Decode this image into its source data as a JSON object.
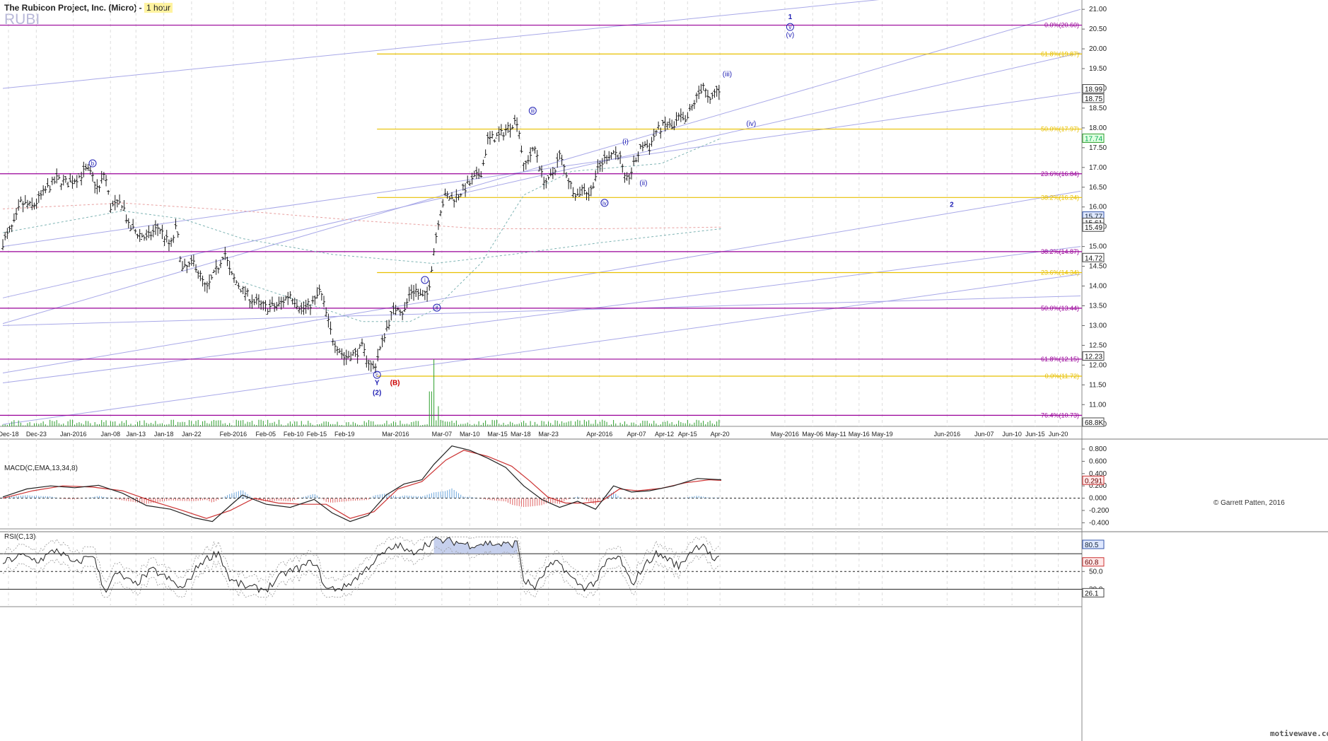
{
  "header": {
    "title": "The Rubicon Project, Inc. (Micro) -",
    "timeframe": "1 hour",
    "symbol": "RUBI",
    "copyright": "© Garrett Patten, 2016",
    "brand": "motivewave.com"
  },
  "colors": {
    "price_bar": "#1a1a1a",
    "magenta_fib": "#990099",
    "gold_fib": "#e8c000",
    "trend_line": "#a8a8e8",
    "wave_label": "#1f1fb4",
    "wave_label_red": "#cc0000",
    "volume": "#2e9e2e",
    "macd_line": "#222222",
    "macd_signal": "#cc3333",
    "histo_pos": "#6fa8dc",
    "histo_neg": "#e06666",
    "rsi_line": "#222222",
    "rsi_band": "#999999",
    "ma_dash": "#7fb4b4"
  },
  "chart_data": [
    {
      "type": "ohlc",
      "pane": "price",
      "ylim": [
        10.45,
        21.2
      ],
      "y_ticks": [
        10.5,
        11.0,
        11.5,
        12.0,
        12.5,
        13.0,
        13.5,
        14.0,
        14.5,
        15.0,
        15.5,
        16.0,
        16.5,
        17.0,
        17.5,
        18.0,
        18.5,
        19.0,
        19.5,
        20.0,
        20.5,
        21.0
      ],
      "y_tick_labels": [
        "10.50",
        "11.00",
        "11.50",
        "12.00",
        "12.50",
        "13.00",
        "13.50",
        "14.00",
        "14.50",
        "15.00",
        "15.50",
        "16.00",
        "16.50",
        "17.00",
        "17.50",
        "18.00",
        "18.50",
        "19.00",
        "19.50",
        "20.00",
        "20.50",
        "21.00"
      ],
      "x_labels": [
        "Dec-18",
        "Dec-23",
        "Jan-2016",
        "Jan-08",
        "Jan-13",
        "Jan-18",
        "Jan-22",
        "Feb-2016",
        "Feb-05",
        "Feb-10",
        "Feb-15",
        "Feb-19",
        "Mar-2016",
        "Mar-07",
        "Mar-10",
        "Mar-15",
        "Mar-18",
        "Mar-23",
        "Apr-2016",
        "Apr-07",
        "Apr-12",
        "Apr-15",
        "Apr-20",
        "May-2016",
        "May-06",
        "May-11",
        "May-16",
        "May-19",
        "Jun-2016",
        "Jun-07",
        "Jun-10",
        "Jun-15",
        "Jun-20"
      ],
      "price_path": [
        {
          "t": 0,
          "p": 15.1
        },
        {
          "t": 2,
          "p": 15.6
        },
        {
          "t": 3,
          "p": 16.1
        },
        {
          "t": 5,
          "p": 16.0
        },
        {
          "t": 7,
          "p": 16.4
        },
        {
          "t": 9,
          "p": 16.7
        },
        {
          "t": 11,
          "p": 16.6
        },
        {
          "t": 13,
          "p": 16.8
        },
        {
          "t": 14,
          "p": 16.95
        },
        {
          "t": 15,
          "p": 16.75
        },
        {
          "t": 16,
          "p": 16.4
        },
        {
          "t": 17,
          "p": 16.9
        },
        {
          "t": 18,
          "p": 16.0
        },
        {
          "t": 20,
          "p": 16.1
        },
        {
          "t": 21,
          "p": 15.5
        },
        {
          "t": 24,
          "p": 15.2
        },
        {
          "t": 26,
          "p": 15.5
        },
        {
          "t": 28,
          "p": 15.0
        },
        {
          "t": 29,
          "p": 15.5
        },
        {
          "t": 30,
          "p": 14.4
        },
        {
          "t": 32,
          "p": 14.6
        },
        {
          "t": 34,
          "p": 13.9
        },
        {
          "t": 36,
          "p": 14.5
        },
        {
          "t": 37,
          "p": 14.9
        },
        {
          "t": 38,
          "p": 14.3
        },
        {
          "t": 40,
          "p": 13.9
        },
        {
          "t": 42,
          "p": 13.6
        },
        {
          "t": 44,
          "p": 13.45
        },
        {
          "t": 46,
          "p": 13.5
        },
        {
          "t": 48,
          "p": 13.8
        },
        {
          "t": 50,
          "p": 13.4
        },
        {
          "t": 52,
          "p": 13.6
        },
        {
          "t": 53,
          "p": 13.9
        },
        {
          "t": 54,
          "p": 13.3
        },
        {
          "t": 55,
          "p": 12.7
        },
        {
          "t": 57,
          "p": 12.2
        },
        {
          "t": 59,
          "p": 12.3
        },
        {
          "t": 60,
          "p": 12.45
        },
        {
          "t": 61,
          "p": 12.1
        },
        {
          "t": 62,
          "p": 11.9
        },
        {
          "t": 63,
          "p": 12.4
        },
        {
          "t": 64,
          "p": 12.9
        },
        {
          "t": 65,
          "p": 13.3
        },
        {
          "t": 66,
          "p": 13.5
        },
        {
          "t": 67,
          "p": 13.3
        },
        {
          "t": 68,
          "p": 13.85
        },
        {
          "t": 69,
          "p": 13.9
        },
        {
          "t": 70,
          "p": 13.7
        },
        {
          "t": 71,
          "p": 13.8
        },
        {
          "t": 72,
          "p": 14.9
        },
        {
          "t": 73,
          "p": 15.9
        },
        {
          "t": 74,
          "p": 16.3
        },
        {
          "t": 75,
          "p": 16.2
        },
        {
          "t": 76,
          "p": 16.3
        },
        {
          "t": 78,
          "p": 16.6
        },
        {
          "t": 80,
          "p": 16.9
        },
        {
          "t": 81,
          "p": 17.7
        },
        {
          "t": 83,
          "p": 17.8
        },
        {
          "t": 85,
          "p": 18.1
        },
        {
          "t": 86,
          "p": 18.2
        },
        {
          "t": 87,
          "p": 17.0
        },
        {
          "t": 88,
          "p": 17.3
        },
        {
          "t": 89,
          "p": 17.5
        },
        {
          "t": 90,
          "p": 16.8
        },
        {
          "t": 91,
          "p": 16.6
        },
        {
          "t": 92,
          "p": 16.9
        },
        {
          "t": 93,
          "p": 17.3
        },
        {
          "t": 94,
          "p": 16.9
        },
        {
          "t": 95,
          "p": 16.5
        },
        {
          "t": 96,
          "p": 16.3
        },
        {
          "t": 97,
          "p": 16.5
        },
        {
          "t": 98,
          "p": 16.3
        },
        {
          "t": 99,
          "p": 16.8
        },
        {
          "t": 100,
          "p": 17.1
        },
        {
          "t": 101,
          "p": 17.3
        },
        {
          "t": 102,
          "p": 17.4
        },
        {
          "t": 103,
          "p": 17.3
        },
        {
          "t": 104,
          "p": 16.6
        },
        {
          "t": 105,
          "p": 16.9
        },
        {
          "t": 106,
          "p": 17.3
        },
        {
          "t": 107,
          "p": 17.6
        },
        {
          "t": 108,
          "p": 17.5
        },
        {
          "t": 109,
          "p": 17.9
        },
        {
          "t": 110,
          "p": 18.0
        },
        {
          "t": 111,
          "p": 18.1
        },
        {
          "t": 112,
          "p": 17.95
        },
        {
          "t": 113,
          "p": 18.3
        },
        {
          "t": 114,
          "p": 18.1
        },
        {
          "t": 115,
          "p": 18.5
        },
        {
          "t": 116,
          "p": 18.8
        },
        {
          "t": 117,
          "p": 19.1
        },
        {
          "t": 118,
          "p": 18.6
        },
        {
          "t": 119,
          "p": 18.95
        },
        {
          "t": 120,
          "p": 18.99
        }
      ],
      "axis_tags": [
        {
          "value": 18.99,
          "label": "18.99",
          "style": "box"
        },
        {
          "value": 18.75,
          "label": "18.75",
          "style": "box"
        },
        {
          "value": 17.74,
          "label": "17.74",
          "style": "green"
        },
        {
          "value": 15.77,
          "label": "15.77",
          "style": "blue"
        },
        {
          "value": 15.61,
          "label": "15.61",
          "style": "box"
        },
        {
          "value": 15.49,
          "label": "15.49",
          "style": "box"
        },
        {
          "value": 14.72,
          "label": "14.72",
          "style": "box"
        },
        {
          "value": 12.23,
          "label": "12.23",
          "style": "box"
        },
        {
          "value": 10.3,
          "label": "68.8K",
          "style": "box"
        }
      ],
      "fib_magenta": [
        {
          "value": 20.6,
          "label": "0.0%(20.60)"
        },
        {
          "value": 16.84,
          "label": "23.6%(16.84)"
        },
        {
          "value": 14.87,
          "label": "38.2%(14.87)"
        },
        {
          "value": 13.44,
          "label": "50.0%(13.44)"
        },
        {
          "value": 12.15,
          "label": "61.8%(12.15)"
        },
        {
          "value": 10.73,
          "label": "76.4%(10.73)"
        }
      ],
      "fib_gold": [
        {
          "value": 19.87,
          "label": "61.8%(19.87)"
        },
        {
          "value": 17.97,
          "label": "50.0%(17.97)"
        },
        {
          "value": 16.24,
          "label": "38.2%(16.24)"
        },
        {
          "value": 14.34,
          "label": "23.6%(14.34)"
        },
        {
          "value": 11.72,
          "label": "0.0%(11.72)"
        }
      ],
      "wave_labels": [
        {
          "t": 15,
          "p": 17.05,
          "text": "b",
          "circled": true
        },
        {
          "t": 62.5,
          "p": 11.7,
          "text": "c",
          "circled": true
        },
        {
          "t": 62.5,
          "p": 11.5,
          "text": "Y",
          "bold": true
        },
        {
          "t": 62.5,
          "p": 11.25,
          "text": "(2)",
          "bold": true
        },
        {
          "t": 65.5,
          "p": 11.5,
          "text": "(B)",
          "bold": true,
          "color": "red"
        },
        {
          "t": 70.5,
          "p": 14.1,
          "text": "i",
          "circled": true
        },
        {
          "t": 72.5,
          "p": 13.4,
          "text": "ii",
          "circled": true
        },
        {
          "t": 88.5,
          "p": 18.38,
          "text": "iii",
          "circled": true
        },
        {
          "t": 100.5,
          "p": 16.05,
          "text": "iv",
          "circled": true
        },
        {
          "t": 104,
          "p": 17.6,
          "text": "(i)"
        },
        {
          "t": 107,
          "p": 16.55,
          "text": "(ii)"
        },
        {
          "t": 121,
          "p": 19.3,
          "text": "(iii)"
        },
        {
          "t": 125,
          "p": 18.05,
          "text": "(iv)"
        },
        {
          "t": 131.5,
          "p": 20.75,
          "text": "1",
          "bold": true
        },
        {
          "t": 131.5,
          "p": 20.5,
          "text": "v",
          "circled": true
        },
        {
          "t": 131.5,
          "p": 20.3,
          "text": "(v)"
        },
        {
          "t": 158.5,
          "p": 16.0,
          "text": "2",
          "bold": true
        }
      ],
      "volume_spikes": [
        {
          "t": 72,
          "v": 1.0
        },
        {
          "t": 71.5,
          "v": 0.52
        }
      ]
    },
    {
      "type": "line",
      "pane": "macd",
      "name": "MACD(C,EMA,13,34,8)",
      "ylim": [
        -0.5,
        0.95
      ],
      "y_ticks": [
        -0.4,
        -0.2,
        0.0,
        0.2,
        0.4,
        0.6,
        0.8
      ],
      "y_tick_labels": [
        "-0.400",
        "-0.200",
        "0.000",
        "0.200",
        "0.400",
        "0.600",
        "0.800"
      ],
      "current_value": 0.291,
      "current_label": "0.291",
      "macd_path": [
        {
          "t": 0,
          "v": 0.02
        },
        {
          "t": 4,
          "v": 0.15
        },
        {
          "t": 8,
          "v": 0.2
        },
        {
          "t": 12,
          "v": 0.17
        },
        {
          "t": 16,
          "v": 0.21
        },
        {
          "t": 20,
          "v": 0.08
        },
        {
          "t": 24,
          "v": -0.12
        },
        {
          "t": 28,
          "v": -0.18
        },
        {
          "t": 32,
          "v": -0.32
        },
        {
          "t": 35,
          "v": -0.38
        },
        {
          "t": 38,
          "v": -0.12
        },
        {
          "t": 40,
          "v": 0.05
        },
        {
          "t": 44,
          "v": -0.1
        },
        {
          "t": 48,
          "v": -0.15
        },
        {
          "t": 52,
          "v": -0.02
        },
        {
          "t": 55,
          "v": -0.24
        },
        {
          "t": 58,
          "v": -0.38
        },
        {
          "t": 61,
          "v": -0.28
        },
        {
          "t": 64,
          "v": 0.05
        },
        {
          "t": 67,
          "v": 0.23
        },
        {
          "t": 70,
          "v": 0.3
        },
        {
          "t": 72,
          "v": 0.55
        },
        {
          "t": 75,
          "v": 0.85
        },
        {
          "t": 78,
          "v": 0.78
        },
        {
          "t": 81,
          "v": 0.65
        },
        {
          "t": 84,
          "v": 0.5
        },
        {
          "t": 87,
          "v": 0.2
        },
        {
          "t": 90,
          "v": -0.02
        },
        {
          "t": 93,
          "v": -0.15
        },
        {
          "t": 96,
          "v": -0.05
        },
        {
          "t": 99,
          "v": -0.18
        },
        {
          "t": 102,
          "v": 0.2
        },
        {
          "t": 105,
          "v": 0.1
        },
        {
          "t": 108,
          "v": 0.12
        },
        {
          "t": 112,
          "v": 0.2
        },
        {
          "t": 116,
          "v": 0.32
        },
        {
          "t": 120,
          "v": 0.3
        }
      ],
      "signal_path": [
        {
          "t": 0,
          "v": 0.0
        },
        {
          "t": 5,
          "v": 0.12
        },
        {
          "t": 10,
          "v": 0.2
        },
        {
          "t": 15,
          "v": 0.18
        },
        {
          "t": 20,
          "v": 0.12
        },
        {
          "t": 25,
          "v": -0.05
        },
        {
          "t": 30,
          "v": -0.2
        },
        {
          "t": 34,
          "v": -0.33
        },
        {
          "t": 38,
          "v": -0.2
        },
        {
          "t": 42,
          "v": 0.0
        },
        {
          "t": 46,
          "v": -0.08
        },
        {
          "t": 50,
          "v": -0.1
        },
        {
          "t": 54,
          "v": -0.1
        },
        {
          "t": 58,
          "v": -0.33
        },
        {
          "t": 62,
          "v": -0.22
        },
        {
          "t": 66,
          "v": 0.15
        },
        {
          "t": 70,
          "v": 0.27
        },
        {
          "t": 74,
          "v": 0.62
        },
        {
          "t": 77,
          "v": 0.78
        },
        {
          "t": 81,
          "v": 0.68
        },
        {
          "t": 85,
          "v": 0.52
        },
        {
          "t": 88,
          "v": 0.28
        },
        {
          "t": 91,
          "v": 0.02
        },
        {
          "t": 94,
          "v": -0.08
        },
        {
          "t": 97,
          "v": -0.08
        },
        {
          "t": 100,
          "v": -0.05
        },
        {
          "t": 103,
          "v": 0.15
        },
        {
          "t": 106,
          "v": 0.12
        },
        {
          "t": 110,
          "v": 0.16
        },
        {
          "t": 114,
          "v": 0.25
        },
        {
          "t": 118,
          "v": 0.3
        },
        {
          "t": 120,
          "v": 0.29
        }
      ]
    },
    {
      "type": "line",
      "pane": "rsi",
      "name": "RSI(C,13)",
      "ylim": [
        20,
        90
      ],
      "y_ticks": [
        30,
        50,
        80
      ],
      "y_tick_labels": [
        "30.0",
        "50.0",
        "80.0"
      ],
      "levels": [
        30,
        50,
        70
      ],
      "current_value": 60.8,
      "current_label": "60.8",
      "upper_tag": "80.5",
      "lower_tag": "26.1",
      "rsi_path": [
        {
          "t": 0,
          "v": 60
        },
        {
          "t": 3,
          "v": 68
        },
        {
          "t": 6,
          "v": 62
        },
        {
          "t": 9,
          "v": 75
        },
        {
          "t": 12,
          "v": 58
        },
        {
          "t": 15,
          "v": 70
        },
        {
          "t": 17,
          "v": 28
        },
        {
          "t": 19,
          "v": 48
        },
        {
          "t": 22,
          "v": 35
        },
        {
          "t": 25,
          "v": 52
        },
        {
          "t": 28,
          "v": 40
        },
        {
          "t": 30,
          "v": 30
        },
        {
          "t": 33,
          "v": 60
        },
        {
          "t": 36,
          "v": 72
        },
        {
          "t": 38,
          "v": 40
        },
        {
          "t": 41,
          "v": 32
        },
        {
          "t": 44,
          "v": 30
        },
        {
          "t": 47,
          "v": 48
        },
        {
          "t": 50,
          "v": 55
        },
        {
          "t": 52,
          "v": 62
        },
        {
          "t": 54,
          "v": 30
        },
        {
          "t": 57,
          "v": 32
        },
        {
          "t": 60,
          "v": 48
        },
        {
          "t": 62,
          "v": 62
        },
        {
          "t": 64,
          "v": 72
        },
        {
          "t": 66,
          "v": 80
        },
        {
          "t": 68,
          "v": 70
        },
        {
          "t": 70,
          "v": 78
        },
        {
          "t": 72,
          "v": 85
        },
        {
          "t": 75,
          "v": 84
        },
        {
          "t": 78,
          "v": 80
        },
        {
          "t": 81,
          "v": 82
        },
        {
          "t": 84,
          "v": 80
        },
        {
          "t": 86,
          "v": 82
        },
        {
          "t": 87,
          "v": 40
        },
        {
          "t": 89,
          "v": 32
        },
        {
          "t": 91,
          "v": 55
        },
        {
          "t": 93,
          "v": 60
        },
        {
          "t": 95,
          "v": 42
        },
        {
          "t": 97,
          "v": 32
        },
        {
          "t": 99,
          "v": 38
        },
        {
          "t": 101,
          "v": 62
        },
        {
          "t": 103,
          "v": 66
        },
        {
          "t": 105,
          "v": 35
        },
        {
          "t": 107,
          "v": 55
        },
        {
          "t": 109,
          "v": 70
        },
        {
          "t": 111,
          "v": 65
        },
        {
          "t": 113,
          "v": 55
        },
        {
          "t": 115,
          "v": 74
        },
        {
          "t": 117,
          "v": 82
        },
        {
          "t": 118,
          "v": 70
        },
        {
          "t": 119,
          "v": 60.8
        },
        {
          "t": 120,
          "v": 66
        }
      ]
    }
  ]
}
